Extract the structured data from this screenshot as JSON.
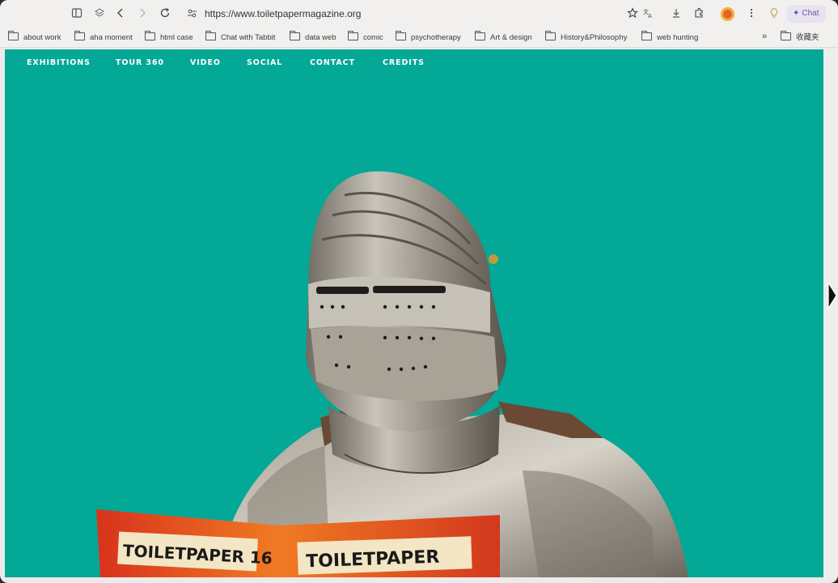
{
  "browser": {
    "url": "https://www.toiletpapermagazine.org",
    "chat_label": "Chat",
    "icons": [
      "sidebar-icon",
      "layers-icon",
      "back-icon",
      "forward-icon",
      "reload-icon",
      "site-info-icon",
      "star-icon",
      "translate-icon",
      "download-icon",
      "extensions-icon",
      "extension-avatar-icon",
      "more-icon",
      "lightbulb-icon",
      "chat-spark-icon"
    ]
  },
  "bookmarks": {
    "items": [
      {
        "label": "about work"
      },
      {
        "label": "aha moment"
      },
      {
        "label": "html case"
      },
      {
        "label": "Chat with Tabbit"
      },
      {
        "label": "data web"
      },
      {
        "label": "comic"
      },
      {
        "label": "psychotherapy"
      },
      {
        "label": "Art & design"
      },
      {
        "label": "History&Philosophy"
      },
      {
        "label": "web hunting"
      }
    ],
    "more_label": "»",
    "favorites_label": "收藏夹"
  },
  "site": {
    "nav": [
      "EXHIBITIONS",
      "TOUR 360",
      "VIDEO",
      "SOCIAL",
      "CONTACT",
      "CREDITS"
    ],
    "background_color": "#04a896",
    "magazine": {
      "left_title": "TOILETPAPER 16",
      "right_title": "TOILETPAPER"
    }
  }
}
